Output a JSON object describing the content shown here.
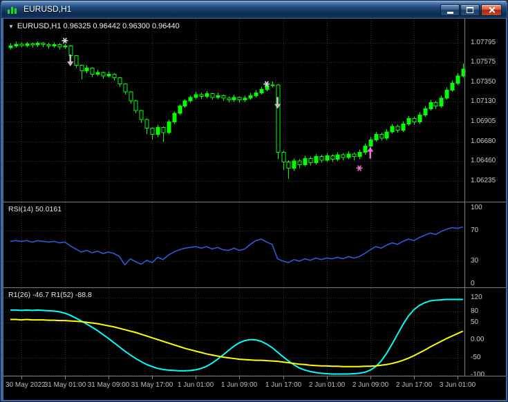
{
  "window": {
    "title": "EURUSD,H1"
  },
  "icons": {
    "chart_menu": "▼"
  },
  "chart_data": [
    {
      "type": "candlestick",
      "symbol": "EURUSD",
      "timeframe": "H1",
      "header": "EURUSD,H1  0.96325 0.96442 0.96300 0.96440",
      "price_scale": [
        "1.07795",
        "1.07575",
        "1.07350",
        "1.07130",
        "1.06905",
        "1.06680",
        "1.06460",
        "1.06235"
      ],
      "ylim": [
        1.06,
        1.0807
      ],
      "colors": {
        "bull": "#00FF00",
        "bear": "#000000",
        "outline": "#00FF00"
      },
      "time_labels": [
        "30 May 2022",
        "31 May 01:00",
        "31 May 09:00",
        "31 May 17:00",
        "1 Jun 01:00",
        "1 Jun 09:00",
        "1 Jun 17:00",
        "2 Jun 01:00",
        "2 Jun 09:00",
        "2 Jun 17:00",
        "3 Jun 01:00"
      ],
      "ohlc": [
        [
          1.0774,
          1.0779,
          1.0772,
          1.0776
        ],
        [
          1.0776,
          1.0781,
          1.0774,
          1.0778
        ],
        [
          1.0778,
          1.078,
          1.07745,
          1.07765
        ],
        [
          1.07765,
          1.07805,
          1.07745,
          1.07785
        ],
        [
          1.07785,
          1.078,
          1.0774,
          1.0777
        ],
        [
          1.0777,
          1.0781,
          1.0775,
          1.0779
        ],
        [
          1.0779,
          1.07805,
          1.07745,
          1.07775
        ],
        [
          1.07775,
          1.07795,
          1.0773,
          1.0776
        ],
        [
          1.0776,
          1.078,
          1.0774,
          1.07775
        ],
        [
          1.07775,
          1.0779,
          1.0772,
          1.0775
        ],
        [
          1.0775,
          1.07785,
          1.0773,
          1.0776
        ],
        [
          1.0776,
          1.0777,
          1.0762,
          1.0765
        ],
        [
          1.0765,
          1.0766,
          1.0751,
          1.0754
        ],
        [
          1.0754,
          1.0755,
          1.0738,
          1.0748
        ],
        [
          1.0748,
          1.0754,
          1.0745,
          1.0751
        ],
        [
          1.0751,
          1.0752,
          1.0741,
          1.0744
        ],
        [
          1.0744,
          1.0749,
          1.0742,
          1.0746
        ],
        [
          1.0746,
          1.0747,
          1.0739,
          1.0742
        ],
        [
          1.0742,
          1.0747,
          1.074,
          1.0744
        ],
        [
          1.0744,
          1.0745,
          1.0737,
          1.074
        ],
        [
          1.074,
          1.0741,
          1.073,
          1.0733
        ],
        [
          1.0733,
          1.0734,
          1.0721,
          1.0724
        ],
        [
          1.0724,
          1.0725,
          1.0711,
          1.0714
        ],
        [
          1.0714,
          1.0715,
          1.07,
          1.0703
        ],
        [
          1.0703,
          1.0704,
          1.0689,
          1.0693
        ],
        [
          1.0693,
          1.0694,
          1.0676,
          1.0683
        ],
        [
          1.0683,
          1.0684,
          1.067,
          1.0676
        ],
        [
          1.0676,
          1.0687,
          1.0673,
          1.0684
        ],
        [
          1.0684,
          1.0685,
          1.0668,
          1.0678
        ],
        [
          1.0678,
          1.0693,
          1.0676,
          1.069
        ],
        [
          1.069,
          1.0702,
          1.0688,
          1.07
        ],
        [
          1.07,
          1.071,
          1.0698,
          1.0708
        ],
        [
          1.0708,
          1.0716,
          1.0706,
          1.0714
        ],
        [
          1.0714,
          1.072,
          1.0712,
          1.0718
        ],
        [
          1.0718,
          1.0724,
          1.0716,
          1.0721
        ],
        [
          1.0721,
          1.0723,
          1.0716,
          1.0719
        ],
        [
          1.0719,
          1.0725,
          1.0717,
          1.0722
        ],
        [
          1.0722,
          1.0723,
          1.0715,
          1.0718
        ],
        [
          1.0718,
          1.0723,
          1.0716,
          1.072
        ],
        [
          1.072,
          1.0721,
          1.0714,
          1.0717
        ],
        [
          1.0717,
          1.0719,
          1.0712,
          1.0715
        ],
        [
          1.0715,
          1.0721,
          1.0713,
          1.0718
        ],
        [
          1.0718,
          1.0719,
          1.0712,
          1.0715
        ],
        [
          1.0715,
          1.072,
          1.0713,
          1.0717
        ],
        [
          1.0717,
          1.0723,
          1.0715,
          1.072
        ],
        [
          1.072,
          1.0726,
          1.0718,
          1.0723
        ],
        [
          1.0723,
          1.073,
          1.0721,
          1.0727
        ],
        [
          1.0727,
          1.0734,
          1.0725,
          1.0731
        ],
        [
          1.0731,
          1.0736,
          1.0729,
          1.0732
        ],
        [
          1.0732,
          1.0733,
          1.0648,
          1.0656
        ],
        [
          1.0656,
          1.0658,
          1.0636,
          1.0645
        ],
        [
          1.0645,
          1.0647,
          1.0626,
          1.0638
        ],
        [
          1.0638,
          1.0649,
          1.0635,
          1.0646
        ],
        [
          1.0646,
          1.0648,
          1.0638,
          1.0642
        ],
        [
          1.0642,
          1.0652,
          1.064,
          1.0649
        ],
        [
          1.0649,
          1.0651,
          1.0641,
          1.0644
        ],
        [
          1.0644,
          1.0654,
          1.0642,
          1.0651
        ],
        [
          1.0651,
          1.0653,
          1.0644,
          1.0647
        ],
        [
          1.0647,
          1.0655,
          1.0645,
          1.0652
        ],
        [
          1.0652,
          1.0654,
          1.0645,
          1.0648
        ],
        [
          1.0648,
          1.0656,
          1.0646,
          1.0653
        ],
        [
          1.0653,
          1.0655,
          1.0647,
          1.065
        ],
        [
          1.065,
          1.0657,
          1.0648,
          1.0654
        ],
        [
          1.0654,
          1.0656,
          1.0647,
          1.0651
        ],
        [
          1.0651,
          1.0659,
          1.0648,
          1.0656
        ],
        [
          1.0656,
          1.0666,
          1.0653,
          1.0663
        ],
        [
          1.0663,
          1.0673,
          1.0661,
          1.067
        ],
        [
          1.067,
          1.0679,
          1.0668,
          1.0676
        ],
        [
          1.0676,
          1.0678,
          1.0669,
          1.0672
        ],
        [
          1.0672,
          1.0682,
          1.067,
          1.0679
        ],
        [
          1.0679,
          1.0688,
          1.0677,
          1.0685
        ],
        [
          1.0685,
          1.0687,
          1.0678,
          1.0681
        ],
        [
          1.0681,
          1.0691,
          1.0679,
          1.0688
        ],
        [
          1.0688,
          1.0697,
          1.0686,
          1.0694
        ],
        [
          1.0694,
          1.0696,
          1.0687,
          1.069
        ],
        [
          1.069,
          1.0701,
          1.0688,
          1.0698
        ],
        [
          1.0698,
          1.0708,
          1.0696,
          1.0705
        ],
        [
          1.0705,
          1.0715,
          1.0703,
          1.0712
        ],
        [
          1.0712,
          1.0714,
          1.0705,
          1.0708
        ],
        [
          1.0708,
          1.072,
          1.0706,
          1.0717
        ],
        [
          1.0717,
          1.0729,
          1.0715,
          1.0726
        ],
        [
          1.0726,
          1.0737,
          1.0724,
          1.0734
        ],
        [
          1.0734,
          1.0745,
          1.0732,
          1.0742
        ],
        [
          1.0742,
          1.0756,
          1.074,
          1.075
        ]
      ],
      "markers": [
        {
          "shape": "star",
          "color": "#D8D8D8",
          "bar": 10,
          "price": 1.0782
        },
        {
          "shape": "arrow-down",
          "color": "#C0C0C0",
          "bar": 11,
          "price": 1.0753
        },
        {
          "shape": "star",
          "color": "#D8D8D8",
          "bar": 47,
          "price": 1.0733
        },
        {
          "shape": "arrow-down",
          "color": "#C0C0C0",
          "bar": 49,
          "price": 1.0705
        },
        {
          "shape": "star",
          "color": "#EE6FC8",
          "bar": 64,
          "price": 1.0638
        },
        {
          "shape": "arrow-up",
          "color": "#EE6FC8",
          "bar": 66,
          "price": 1.0662
        }
      ]
    },
    {
      "type": "line",
      "name": "RSI(14)",
      "label": "RSI(14) 50.0161",
      "color": "#2E5BD7",
      "scale": [
        "100",
        "70",
        "30",
        "0"
      ],
      "levels": [
        70,
        30
      ],
      "ylim": [
        0,
        100
      ],
      "values": [
        56,
        57,
        56,
        57,
        55,
        57,
        56,
        55,
        56,
        54,
        55,
        50,
        46,
        42,
        44,
        41,
        43,
        40,
        42,
        40,
        36,
        25,
        33,
        29,
        26,
        31,
        28,
        35,
        32,
        38,
        42,
        45,
        47,
        48,
        49,
        47,
        49,
        46,
        48,
        45,
        44,
        47,
        44,
        46,
        52,
        57,
        59,
        55,
        52,
        33,
        30,
        28,
        32,
        30,
        33,
        31,
        34,
        32,
        34,
        33,
        35,
        33,
        36,
        34,
        36,
        40,
        45,
        49,
        47,
        51,
        54,
        52,
        56,
        59,
        57,
        61,
        64,
        67,
        65,
        69,
        72,
        74,
        73,
        75
      ]
    },
    {
      "type": "line",
      "label": "R1(26) -46.7  R1(52) -88.8",
      "scale": [
        "120",
        "80",
        "50",
        "0.00",
        "-50",
        "-100"
      ],
      "ylim": [
        -100,
        120
      ],
      "series": [
        {
          "name": "R1(26)",
          "color": "#00FFFF",
          "values": [
            85,
            85,
            84,
            85,
            84,
            85,
            84,
            83,
            82,
            80,
            76,
            70,
            62,
            54,
            45,
            36,
            26,
            15,
            4,
            -8,
            -20,
            -32,
            -43,
            -53,
            -62,
            -70,
            -76,
            -81,
            -84,
            -86,
            -87,
            -88,
            -88,
            -87,
            -85,
            -81,
            -75,
            -66,
            -55,
            -43,
            -30,
            -18,
            -8,
            -2,
            1,
            0,
            -4,
            -12,
            -22,
            -35,
            -48,
            -60,
            -71,
            -80,
            -86,
            -90,
            -93,
            -95,
            -96,
            -97,
            -97,
            -97,
            -97,
            -96,
            -95,
            -92,
            -86,
            -76,
            -60,
            -38,
            -12,
            16,
            44,
            68,
            86,
            98,
            106,
            111,
            113,
            114,
            115,
            115,
            115,
            115
          ]
        },
        {
          "name": "R1(52)",
          "color": "#FFFF00",
          "values": [
            58,
            58,
            57,
            58,
            57,
            57,
            57,
            56,
            56,
            55,
            55,
            54,
            53,
            52,
            50,
            48,
            46,
            43,
            40,
            37,
            33,
            29,
            25,
            21,
            16,
            11,
            6,
            1,
            -4,
            -9,
            -14,
            -19,
            -24,
            -28,
            -32,
            -36,
            -40,
            -43,
            -46,
            -49,
            -51,
            -53,
            -55,
            -56,
            -57,
            -58,
            -58,
            -59,
            -60,
            -61,
            -63,
            -65,
            -67,
            -69,
            -70,
            -72,
            -73,
            -74,
            -74,
            -75,
            -75,
            -76,
            -76,
            -76,
            -76,
            -75,
            -75,
            -74,
            -72,
            -70,
            -67,
            -63,
            -58,
            -52,
            -45,
            -37,
            -29,
            -20,
            -12,
            -4,
            4,
            11,
            18,
            25
          ]
        }
      ]
    }
  ]
}
